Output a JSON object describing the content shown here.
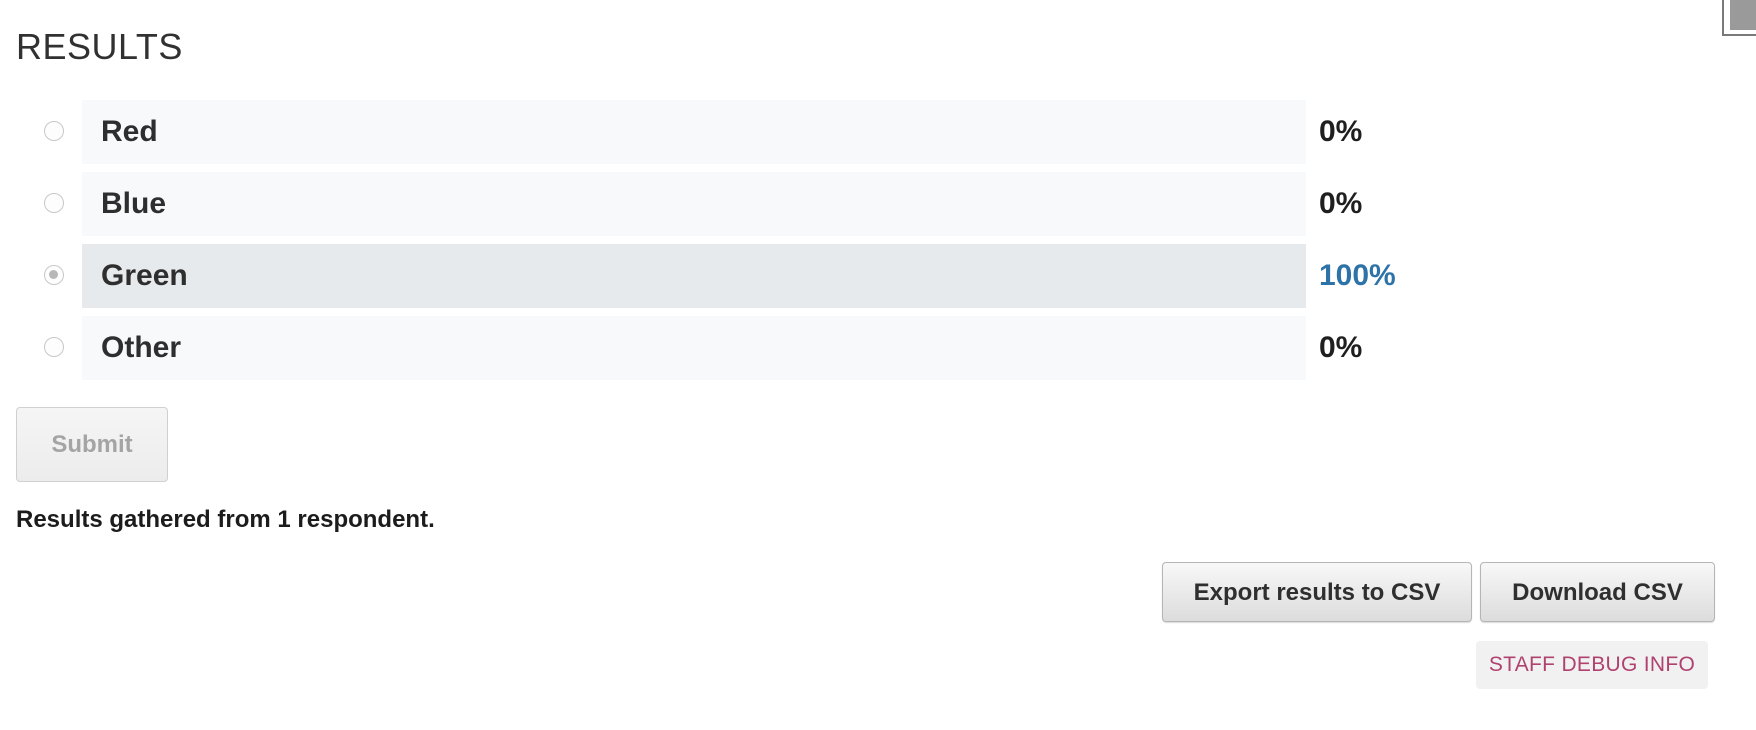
{
  "section": {
    "title": "RESULTS"
  },
  "options": [
    {
      "label": "Red",
      "percent": "0%",
      "percent_value": 0,
      "selected": false
    },
    {
      "label": "Blue",
      "percent": "0%",
      "percent_value": 0,
      "selected": false
    },
    {
      "label": "Green",
      "percent": "100%",
      "percent_value": 100,
      "selected": true
    },
    {
      "label": "Other",
      "percent": "0%",
      "percent_value": 0,
      "selected": false
    }
  ],
  "form": {
    "submit_label": "Submit",
    "submit_disabled": true
  },
  "summary": {
    "respondents_text": "Results gathered from 1 respondent."
  },
  "actions": {
    "export_label": "Export results to CSV",
    "download_label": "Download CSV",
    "debug_label": "STAFF DEBUG INFO"
  },
  "colors": {
    "selected_percent": "#2d73a8",
    "debug_text": "#b0426f",
    "selected_bar": "#e6eaec",
    "bar": "#f8f9fa"
  }
}
